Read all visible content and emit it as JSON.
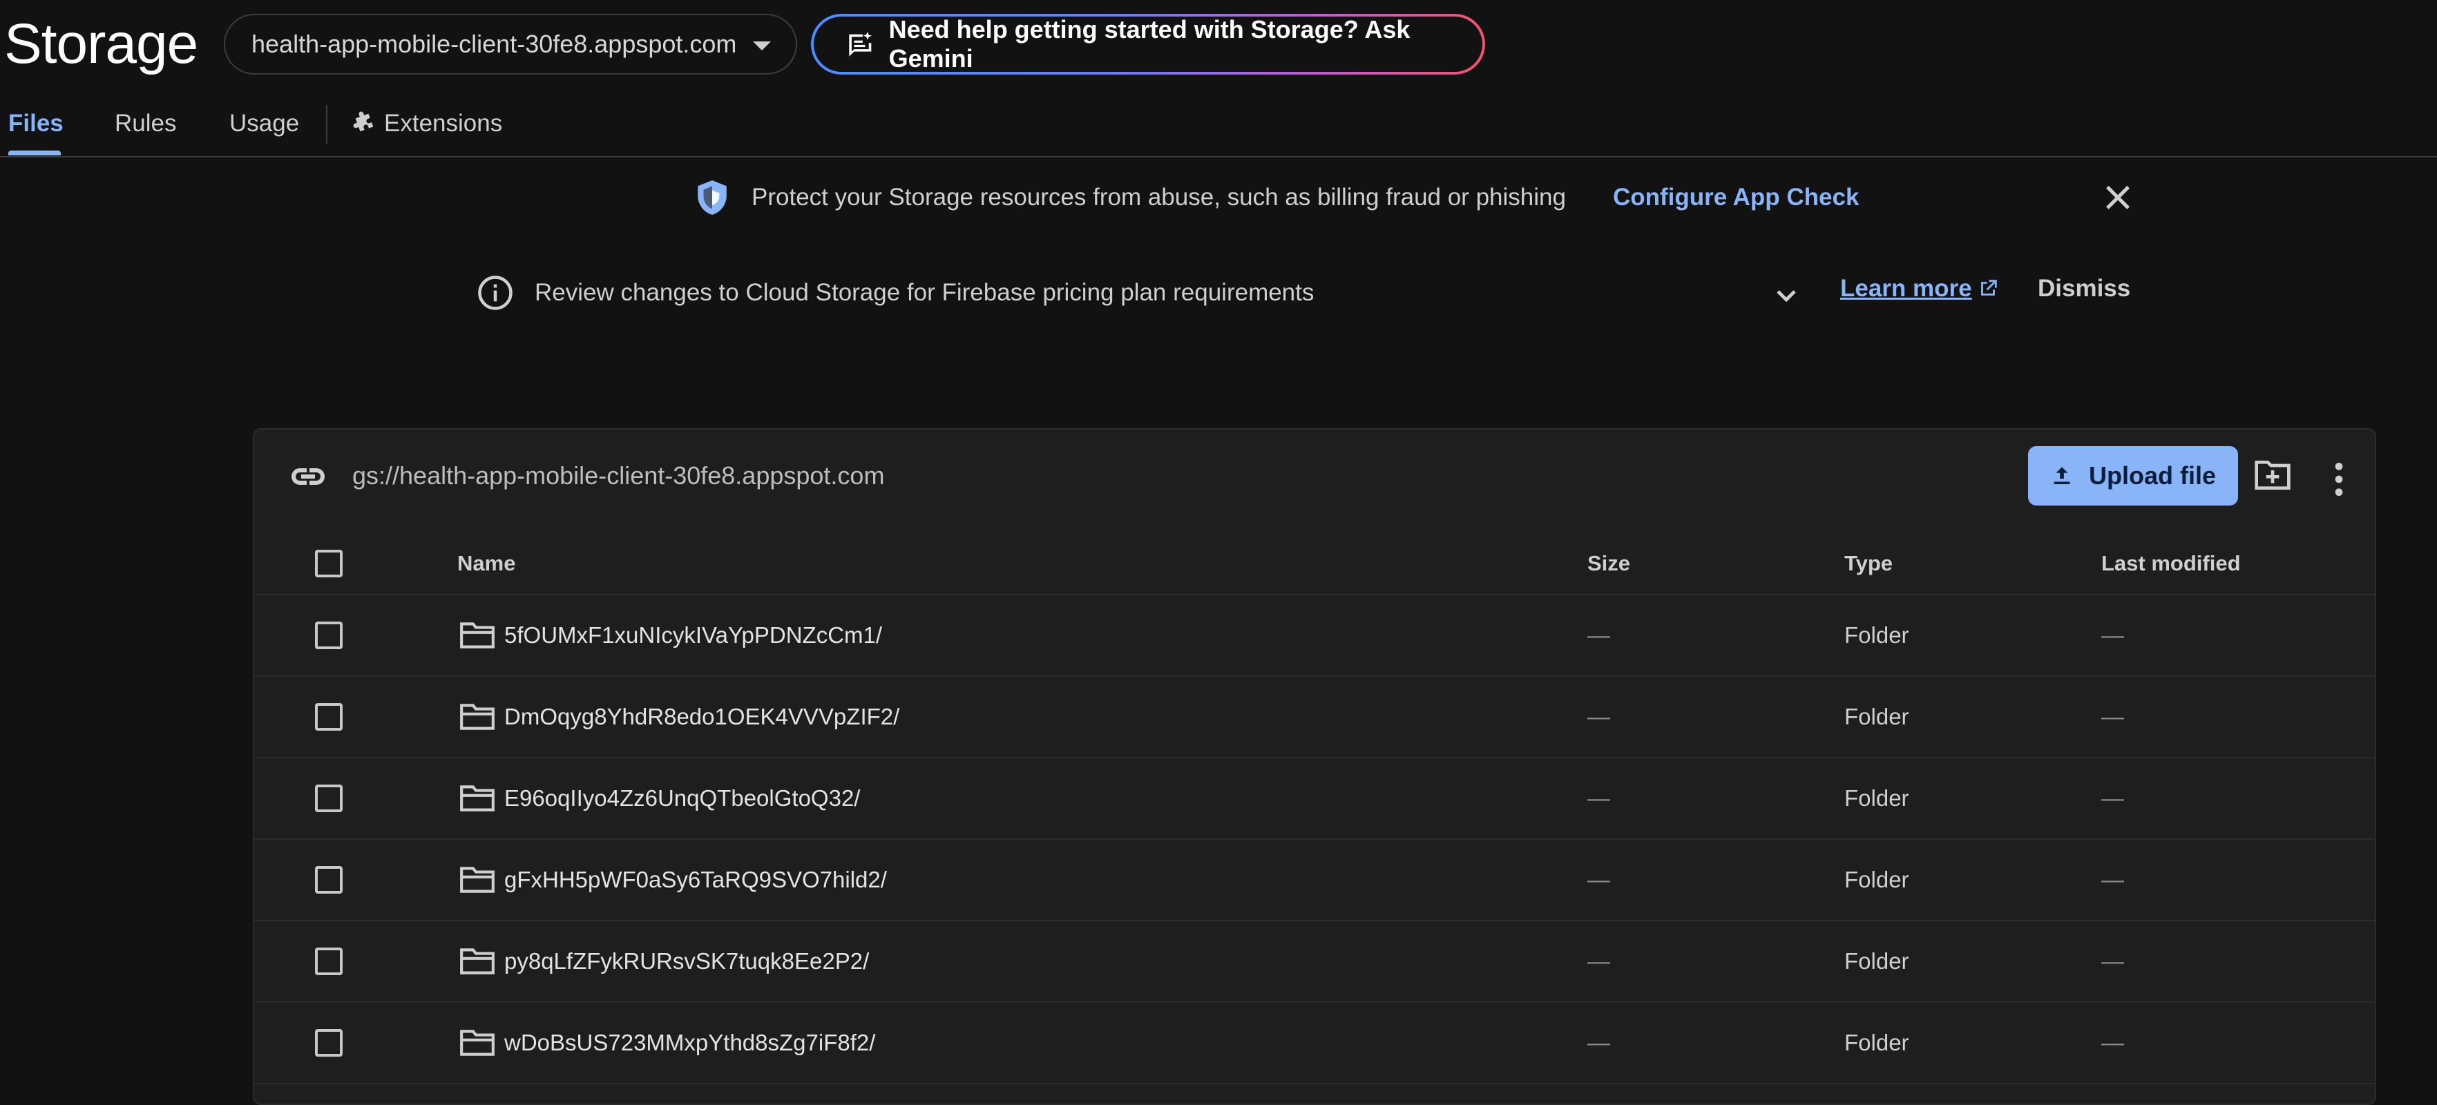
{
  "header": {
    "title": "Storage",
    "bucket": "health-app-mobile-client-30fe8.appspot.com",
    "gemini_label": "Need help getting started with Storage? Ask Gemini"
  },
  "tabs": [
    {
      "label": "Files",
      "active": true
    },
    {
      "label": "Rules",
      "active": false
    },
    {
      "label": "Usage",
      "active": false
    },
    {
      "label": "Extensions",
      "active": false
    }
  ],
  "banners": {
    "appcheck": {
      "text": "Protect your Storage resources from abuse, such as billing fraud or phishing",
      "link": "Configure App Check"
    },
    "pricing": {
      "text": "Review changes to Cloud Storage for Firebase pricing plan requirements",
      "learn_more": "Learn more",
      "dismiss": "Dismiss"
    }
  },
  "file_browser": {
    "path": "gs://health-app-mobile-client-30fe8.appspot.com",
    "upload_label": "Upload file",
    "columns": {
      "name": "Name",
      "size": "Size",
      "type": "Type",
      "modified": "Last modified"
    },
    "rows": [
      {
        "name": "5fOUMxF1xuNIcykIVaYpPDNZcCm1/",
        "size": "—",
        "type": "Folder",
        "modified": "—"
      },
      {
        "name": "DmOqyg8YhdR8edo1OEK4VVVpZIF2/",
        "size": "—",
        "type": "Folder",
        "modified": "—"
      },
      {
        "name": "E96oqIIyo4Zz6UnqQTbeolGtoQ32/",
        "size": "—",
        "type": "Folder",
        "modified": "—"
      },
      {
        "name": "gFxHH5pWF0aSy6TaRQ9SVO7hild2/",
        "size": "—",
        "type": "Folder",
        "modified": "—"
      },
      {
        "name": "py8qLfZFykRURsvSK7tuqk8Ee2P2/",
        "size": "—",
        "type": "Folder",
        "modified": "—"
      },
      {
        "name": "wDoBsUS723MMxpYthd8sZg7iF8f2/",
        "size": "—",
        "type": "Folder",
        "modified": "—"
      }
    ]
  },
  "colors": {
    "accent": "#8ab4f8",
    "background": "#121212",
    "card": "#1e1e1e"
  }
}
